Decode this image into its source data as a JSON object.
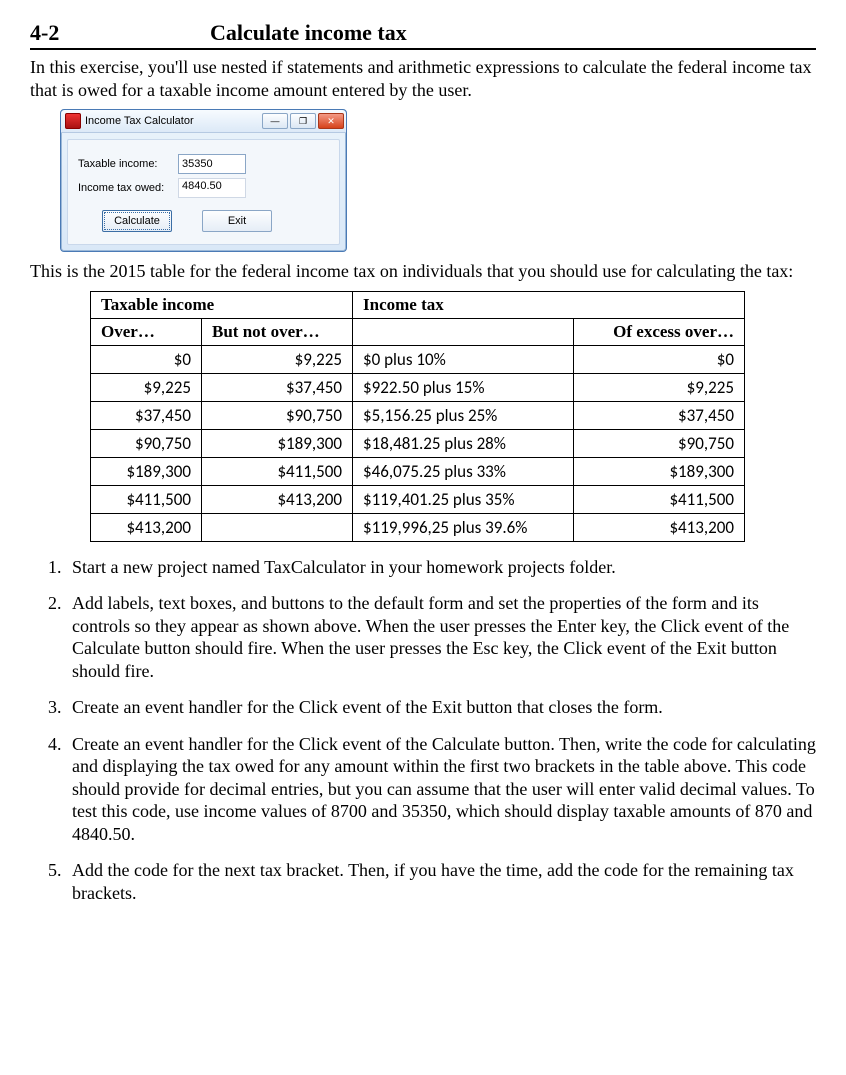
{
  "header": {
    "section_number": "4-2",
    "title": "Calculate income tax"
  },
  "intro": "In this exercise, you'll use nested if statements and arithmetic expressions to calculate the federal income tax that is owed for a taxable income amount entered by the user.",
  "app": {
    "title": "Income Tax Calculator",
    "min_glyph": "—",
    "max_glyph": "❐",
    "close_glyph": "✕",
    "label_taxable": "Taxable income:",
    "label_owed": "Income tax owed:",
    "value_taxable": "35350",
    "value_owed": "4840.50",
    "btn_calculate": "Calculate",
    "btn_exit": "Exit"
  },
  "table_intro": "This is the 2015 table for the federal income tax on individuals that you should use for calculating the tax:",
  "table": {
    "head_taxable": "Taxable income",
    "head_income_tax": "Income tax",
    "head_over": "Over…",
    "head_but_not_over": "But not over…",
    "head_excess": "Of excess over…",
    "rows": [
      {
        "over": "$0",
        "not_over": "$9,225",
        "tax": "$0 plus 10%",
        "excess": "$0"
      },
      {
        "over": "$9,225",
        "not_over": "$37,450",
        "tax": "$922.50 plus 15%",
        "excess": "$9,225"
      },
      {
        "over": "$37,450",
        "not_over": "$90,750",
        "tax": "$5,156.25 plus 25%",
        "excess": "$37,450"
      },
      {
        "over": "$90,750",
        "not_over": "$189,300",
        "tax": "$18,481.25 plus 28%",
        "excess": "$90,750"
      },
      {
        "over": "$189,300",
        "not_over": "$411,500",
        "tax": "$46,075.25 plus 33%",
        "excess": "$189,300"
      },
      {
        "over": "$411,500",
        "not_over": "$413,200",
        "tax": "$119,401.25 plus 35%",
        "excess": "$411,500"
      },
      {
        "over": "$413,200",
        "not_over": "",
        "tax": "$119,996,25 plus 39.6%",
        "excess": "$413,200"
      }
    ]
  },
  "steps": [
    "Start a new project named TaxCalculator in your homework projects folder.",
    "Add labels, text boxes, and buttons to the default form and set the properties of the form and its controls so they appear as shown above. When the user presses the Enter key, the Click event of the Calculate button should fire. When the user presses the Esc key, the Click event of the Exit button should fire.",
    "Create an event handler for the Click event of the Exit button that closes the form.",
    "Create an event handler for the Click event of the Calculate button. Then, write the code for calculating and displaying the tax owed for any amount within the first two brackets in the table above. This code should provide for decimal entries, but you can assume that the user will enter valid decimal values. To test this code, use income values of 8700 and 35350, which should display taxable amounts of 870 and 4840.50.",
    "Add the code for the next tax bracket. Then, if you have the time, add the code for the remaining tax brackets."
  ]
}
